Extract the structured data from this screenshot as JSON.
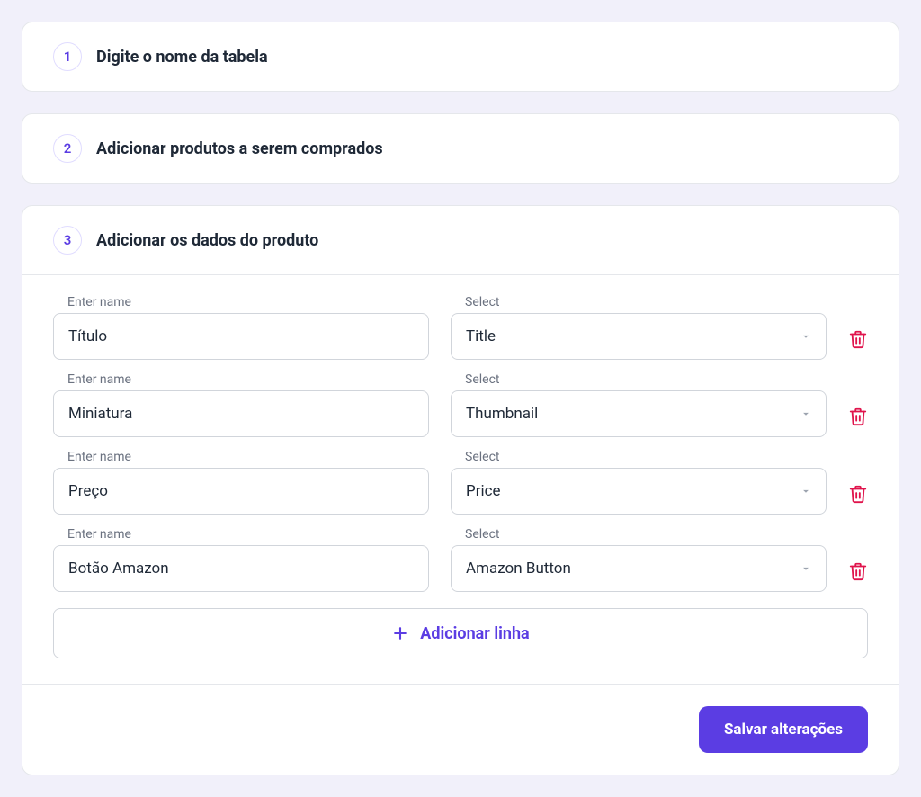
{
  "steps": {
    "one": {
      "number": "1",
      "title": "Digite o nome da tabela"
    },
    "two": {
      "number": "2",
      "title": "Adicionar produtos a serem comprados"
    },
    "three": {
      "number": "3",
      "title": "Adicionar os dados do produto"
    }
  },
  "labels": {
    "enter_name": "Enter name",
    "select": "Select"
  },
  "rows": [
    {
      "name": "Título",
      "select": "Title"
    },
    {
      "name": "Miniatura",
      "select": "Thumbnail"
    },
    {
      "name": "Preço",
      "select": "Price"
    },
    {
      "name": "Botão Amazon",
      "select": "Amazon Button"
    }
  ],
  "buttons": {
    "add_row": "Adicionar linha",
    "save": "Salvar alterações"
  }
}
